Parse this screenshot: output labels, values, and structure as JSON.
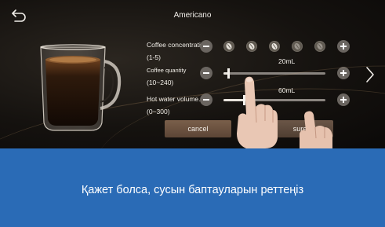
{
  "header": {
    "title": "Americano"
  },
  "settings": {
    "concentration": {
      "label": "Coffee concentration",
      "range": "(1-5)",
      "level": 3,
      "max": 5
    },
    "quantity": {
      "label": "Coffee quantity",
      "range": "(10~240)",
      "value_text": "20mL",
      "value": 20,
      "min": 10,
      "max": 240
    },
    "hot_water": {
      "label": "Hot water volume...",
      "range": "(0~300)",
      "value_text": "60mL",
      "value": 60,
      "min": 0,
      "max": 300
    }
  },
  "buttons": {
    "cancel": "cancel",
    "sure": "sure"
  },
  "caption": "Қажет болса, сусын баптауларын реттеңіз",
  "colors": {
    "caption_band": "#2a6bb6",
    "screen_bg": "#15120f",
    "bean_active": "#e8e4dd",
    "bean_inactive": "#9a948c"
  },
  "icons": [
    "back-arrow-icon",
    "chevron-right-icon",
    "coffee-bean-icon",
    "plus-icon",
    "minus-icon"
  ]
}
